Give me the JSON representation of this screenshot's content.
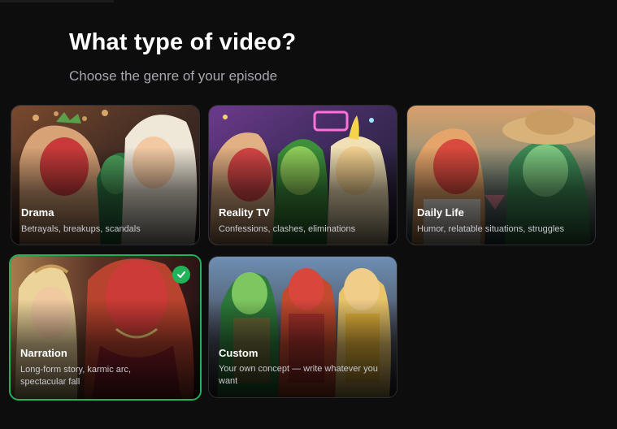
{
  "header": {
    "title": "What type of video?",
    "subtitle": "Choose the genre of your episode"
  },
  "genres": [
    {
      "title": "Drama",
      "description": "Betrayals, breakups, scandals",
      "selected": false
    },
    {
      "title": "Reality TV",
      "description": "Confessions, clashes, eliminations",
      "selected": false
    },
    {
      "title": "Daily Life",
      "description": "Humor, relatable situations, struggles",
      "selected": false
    },
    {
      "title": "Narration",
      "description": "Long-form story, karmic arc, spectacular fall",
      "selected": true
    },
    {
      "title": "Custom",
      "description": "Your own concept — write whatever you want",
      "selected": false
    }
  ],
  "colors": {
    "background": "#0d0d0e",
    "selected_border": "#22b35a",
    "subtitle": "#a6a6ad"
  },
  "icons": {
    "selected": "checkmark-icon"
  }
}
